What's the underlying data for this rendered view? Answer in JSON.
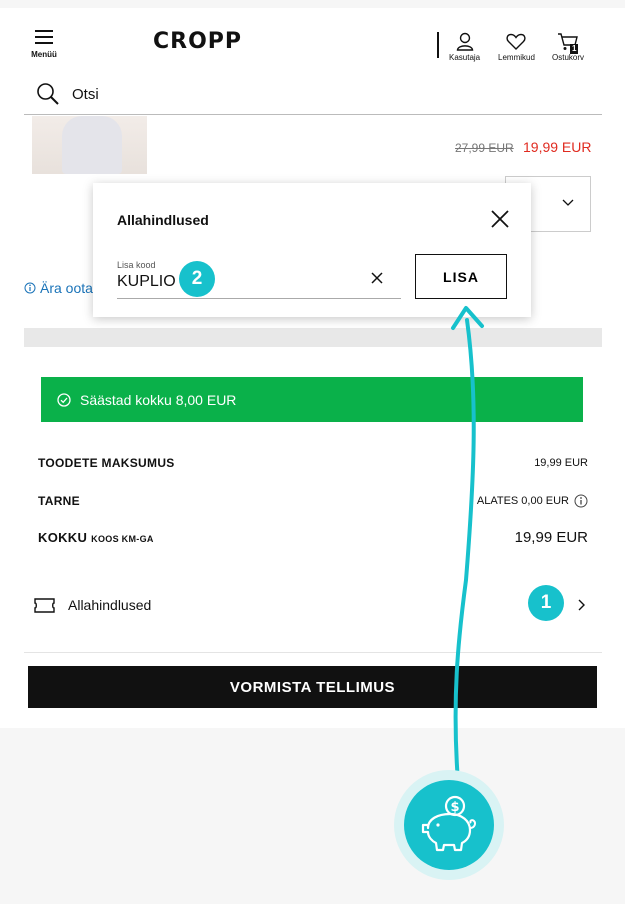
{
  "header": {
    "menu_label": "Menüü",
    "logo": "CROPP",
    "account_label": "Kasutaja",
    "favorites_label": "Lemmikud",
    "cart_label": "Ostukorv",
    "cart_count": "1"
  },
  "search": {
    "placeholder": "Otsi"
  },
  "product": {
    "old_price": "27,99 EUR",
    "new_price": "19,99 EUR"
  },
  "wait_link": "Ära oota",
  "discount_modal": {
    "title": "Allahindlused",
    "code_label": "Lisa kood",
    "code_value": "KUPLIO",
    "add_button": "LISA"
  },
  "savings_banner": "Säästad kokku 8,00 EUR",
  "summary": {
    "products_label": "TOODETE MAKSUMUS",
    "products_value": "19,99 EUR",
    "shipping_label": "TARNE",
    "shipping_value": "ALATES 0,00 EUR",
    "total_label": "KOKKU",
    "total_sub": "KOOS KM-GA",
    "total_value": "19,99 EUR"
  },
  "discounts_row": {
    "label": "Allahindlused"
  },
  "checkout_button": "VORMISTA TELLIMUS",
  "annotations": {
    "step1": "1",
    "step2": "2"
  },
  "colors": {
    "accent": "#17c1cc",
    "sale_red": "#e02b20",
    "success_green": "#0ab14a",
    "link_blue": "#1a73b8"
  }
}
